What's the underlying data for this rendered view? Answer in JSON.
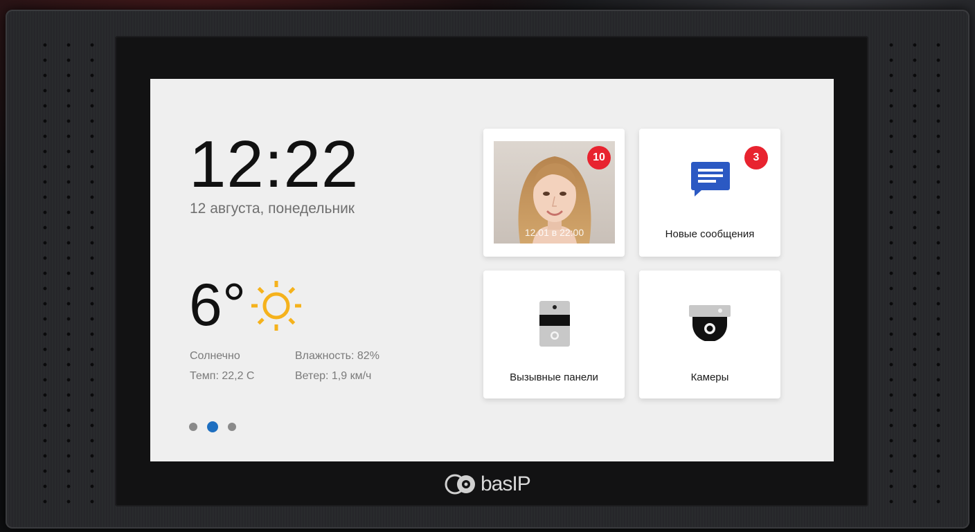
{
  "home": {
    "time": "12:22",
    "date": "12 августа, понедельник"
  },
  "weather": {
    "temperature": "6°",
    "icon": "sun-icon",
    "condition": "Солнечно",
    "temp_detail": "Темп: 22,2 С",
    "humidity": "Влажность: 82%",
    "wind": "Ветер: 1,9 км/ч"
  },
  "pager": {
    "pages": 3,
    "active": 2
  },
  "tiles": {
    "visitor": {
      "badge": "10",
      "caption": "12.01 в 22:00"
    },
    "messages": {
      "badge": "3",
      "label": "Новые сообщения",
      "icon": "message-icon"
    },
    "panels": {
      "label": "Вызывные панели",
      "icon": "door-panel-icon"
    },
    "cameras": {
      "label": "Камеры",
      "icon": "dome-camera-icon"
    }
  },
  "brand": {
    "logo_text": "basIP"
  },
  "colors": {
    "accent": "#1e6fc0",
    "badge": "#e8232f",
    "sun": "#f5b21c",
    "message": "#2b59c3"
  }
}
